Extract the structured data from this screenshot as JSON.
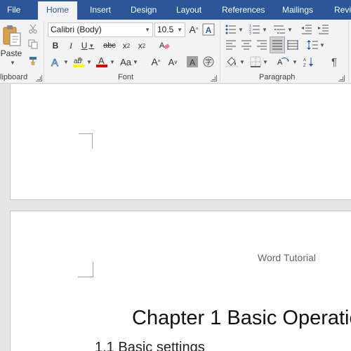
{
  "tabs": [
    {
      "label": "File"
    },
    {
      "label": "Home"
    },
    {
      "label": "Insert"
    },
    {
      "label": "Design"
    },
    {
      "label": "Layout"
    },
    {
      "label": "References"
    },
    {
      "label": "Mailings"
    },
    {
      "label": "Revi"
    }
  ],
  "ribbon": {
    "clipboard": {
      "paste_label": "Paste",
      "group_label": "lipboard"
    },
    "font": {
      "font_name": "Calibri (Body)",
      "font_size": "10.5",
      "group_label": "Font",
      "highlight_color": "#ffff00",
      "font_color": "#e00000"
    },
    "paragraph": {
      "group_label": "Paragraph"
    }
  },
  "document": {
    "header": "Word Tutorial",
    "chapter_title": "Chapter 1 Basic Operatio",
    "section_title": "1.1 Basic settings"
  }
}
